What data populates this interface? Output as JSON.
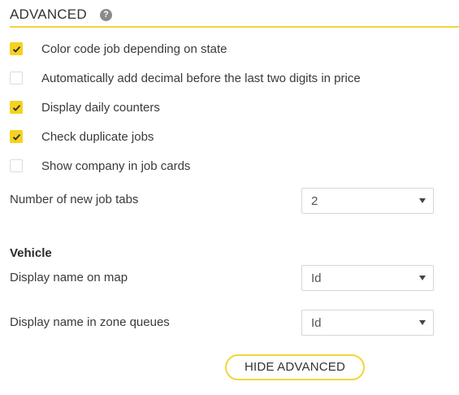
{
  "header": {
    "title": "ADVANCED",
    "help_icon": "question-circle-icon",
    "help_glyph": "?",
    "accent_color": "#f2d53c"
  },
  "options": [
    {
      "label": "Color code job depending on state",
      "checked": true
    },
    {
      "label": "Automatically add decimal before the last two digits in price",
      "checked": false
    },
    {
      "label": "Display daily counters",
      "checked": true
    },
    {
      "label": "Check duplicate jobs",
      "checked": true
    },
    {
      "label": "Show company in job cards",
      "checked": false
    }
  ],
  "new_job_tabs": {
    "label": "Number of new job tabs",
    "value": "2"
  },
  "vehicle": {
    "heading": "Vehicle",
    "map_name": {
      "label": "Display name on map",
      "value": "Id"
    },
    "zone_queue_name": {
      "label": "Display name in zone queues",
      "value": "Id"
    }
  },
  "hide_advanced_label": "HIDE ADVANCED",
  "checkbox_color": "#f5d21f"
}
